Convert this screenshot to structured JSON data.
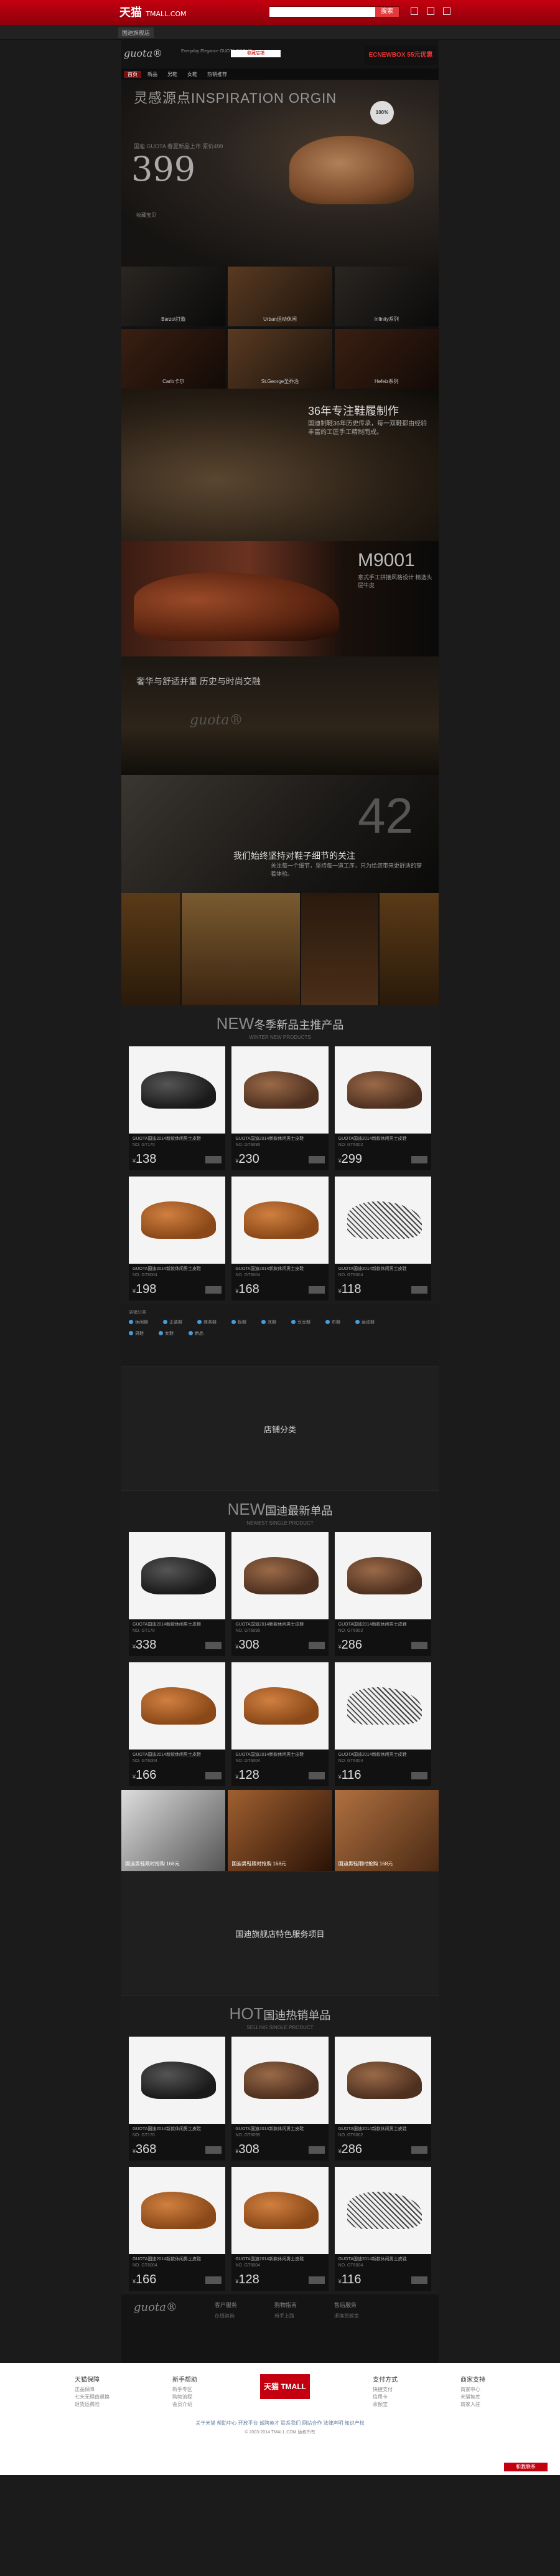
{
  "topbar": {
    "logo_cn": "天猫",
    "logo_en": "TMALL.COM",
    "search_button": "搜索"
  },
  "subbar": {
    "tag": "国迪旗舰店"
  },
  "brand": {
    "name": "guota®",
    "sub": "Everyday Elegance GUOTA GROUP",
    "collect": "收藏店铺",
    "promo": "ECNEWBOX 55元优惠"
  },
  "nav": [
    "首页",
    "新品",
    "男鞋",
    "女鞋",
    "热销推荐"
  ],
  "hero": {
    "title": "灵感源点INSPIRATION ORGIN",
    "subtitle": "国迪 GUOTA 春夏新品上市 原价499",
    "price": "399",
    "badge": "100%",
    "fav": "收藏宝贝"
  },
  "tiles": [
    "Barzot打造",
    "Urban运动休闲",
    "Infinity系列",
    "Carlo卡尔",
    "St.George圣乔治",
    "Hefeiz系列"
  ],
  "story": {
    "title": "36年专注鞋履制作",
    "text": "国迪制鞋36年历史传承，每一双鞋都由经验丰富的工匠手工精制而成。"
  },
  "m9001": {
    "title": "M9001",
    "text": "意式手工拼接风格设计 精选头层牛皮"
  },
  "craft": {
    "title": "奢华与舒适并重 历史与时尚交融",
    "logo": "guota®"
  },
  "sole": {
    "num": "42",
    "title": "我们始终坚持对鞋子细节的关注",
    "text": "关注每一个细节，坚持每一道工序，只为给您带来更舒适的穿着体验。"
  },
  "section1": {
    "big": "NEW",
    "label": "冬季新品主推产品",
    "small": "WINTER NEW PRODUCTS"
  },
  "products1": [
    {
      "name": "GUOTA国迪2014新款休闲男士皮鞋",
      "meta": "NO. GT170",
      "price": "138",
      "tone": "black"
    },
    {
      "name": "GUOTA国迪2014新款休闲男士皮鞋",
      "meta": "NO. GT6095",
      "price": "230",
      "tone": "brown"
    },
    {
      "name": "GUOTA国迪2014新款休闲男士皮鞋",
      "meta": "NO. GT6002",
      "price": "299",
      "tone": "brown"
    },
    {
      "name": "GUOTA国迪2014新款休闲男士皮鞋",
      "meta": "NO. GT6004",
      "price": "198",
      "tone": "tan"
    },
    {
      "name": "GUOTA国迪2014新款休闲男士皮鞋",
      "meta": "NO. GT6004",
      "price": "168",
      "tone": "tan"
    },
    {
      "name": "GUOTA国迪2014新款休闲男士皮鞋",
      "meta": "NO. GT6004",
      "price": "118",
      "tone": "white"
    }
  ],
  "cats": {
    "title": "店铺分类",
    "row1": [
      "休闲鞋",
      "正装鞋",
      "商务鞋",
      "板鞋",
      "凉鞋",
      "豆豆鞋",
      "布鞋",
      "运动鞋"
    ],
    "row2": [
      "男鞋",
      "女鞋",
      "新品"
    ]
  },
  "placeholder1": "店铺分类",
  "section2": {
    "big": "NEW",
    "label": "国迪最新单品",
    "small": "NEWEST SINGLE PRODUCT"
  },
  "products2": [
    {
      "name": "GUOTA国迪2014新款休闲男士皮鞋",
      "meta": "NO. GT170",
      "price": "338",
      "tone": "black"
    },
    {
      "name": "GUOTA国迪2014新款休闲男士皮鞋",
      "meta": "NO. GT6095",
      "price": "308",
      "tone": "brown"
    },
    {
      "name": "GUOTA国迪2014新款休闲男士皮鞋",
      "meta": "NO. GT6002",
      "price": "286",
      "tone": "brown"
    },
    {
      "name": "GUOTA国迪2014新款休闲男士皮鞋",
      "meta": "NO. GT6004",
      "price": "166",
      "tone": "tan"
    },
    {
      "name": "GUOTA国迪2014新款休闲男士皮鞋",
      "meta": "NO. GT6004",
      "price": "128",
      "tone": "tan"
    },
    {
      "name": "GUOTA国迪2014新款休闲男士皮鞋",
      "meta": "NO. GT6004",
      "price": "116",
      "tone": "white"
    }
  ],
  "promo3": [
    "国迪男鞋限时抢购 168元",
    "国迪男鞋限时抢购 168元",
    "国迪男鞋限时抢购 168元"
  ],
  "placeholder2": "国迪旗舰店特色服务项目",
  "section3": {
    "big": "HOT",
    "label": "国迪热销单品",
    "small": "SELLING SINGLE PRODUCT"
  },
  "products3": [
    {
      "name": "GUOTA国迪2014新款休闲男士皮鞋",
      "meta": "NO. GT170",
      "price": "368",
      "tone": "black"
    },
    {
      "name": "GUOTA国迪2014新款休闲男士皮鞋",
      "meta": "NO. GT6095",
      "price": "308",
      "tone": "brown"
    },
    {
      "name": "GUOTA国迪2014新款休闲男士皮鞋",
      "meta": "NO. GT6002",
      "price": "286",
      "tone": "brown"
    },
    {
      "name": "GUOTA国迪2014新款休闲男士皮鞋",
      "meta": "NO. GT6004",
      "price": "166",
      "tone": "tan"
    },
    {
      "name": "GUOTA国迪2014新款休闲男士皮鞋",
      "meta": "NO. GT6004",
      "price": "128",
      "tone": "tan"
    },
    {
      "name": "GUOTA国迪2014新款休闲男士皮鞋",
      "meta": "NO. GT6004",
      "price": "116",
      "tone": "white"
    }
  ],
  "footer_dark": {
    "logo": "guota®",
    "c1h": "客户服务",
    "c1v": "在线咨询",
    "c2h": "购物指南",
    "c2v": "新手上路",
    "c3h": "售后服务",
    "c3v": "退换货政策"
  },
  "footer_white": {
    "cols": [
      {
        "h": "天猫保障",
        "items": [
          "正品保障",
          "七天无理由退换",
          "退货运费险"
        ]
      },
      {
        "h": "新手帮助",
        "items": [
          "新手专区",
          "购物流程",
          "会员介绍"
        ]
      },
      {
        "h": "支付方式",
        "items": [
          "快捷支付",
          "信用卡",
          "余额宝"
        ]
      },
      {
        "h": "商家支持",
        "items": [
          "商家中心",
          "天猫智库",
          "商家入驻"
        ]
      }
    ],
    "tmall": "天猫 TMALL",
    "links": "关于天猫 帮助中心 开放平台 诚聘英才 联系我们 网站合作 法律声明 知识产权",
    "copy": "© 2003-2014 TMALL.COM 版权所有",
    "chat": "和我联系"
  }
}
